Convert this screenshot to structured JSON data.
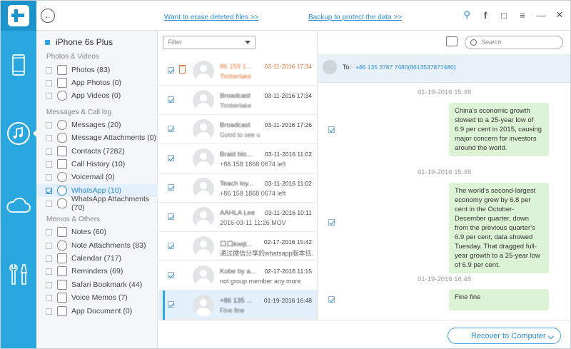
{
  "header": {
    "link_erase": "Want to erase deleted files >>",
    "link_backup": "Backup to protect the data >>"
  },
  "device": {
    "name": "iPhone 6s Plus"
  },
  "sidebar": {
    "groups": [
      "Photos & Videos",
      "Messages & Call log",
      "Memos & Others"
    ],
    "items": [
      {
        "label": "Photos (83)"
      },
      {
        "label": "App Photos (0)"
      },
      {
        "label": "App Videos (0)"
      },
      {
        "label": "Messages (20)"
      },
      {
        "label": "Message Attachments (0)"
      },
      {
        "label": "Contacts (7282)"
      },
      {
        "label": "Call History (10)"
      },
      {
        "label": "Voicemail (0)"
      },
      {
        "label": "WhatsApp (10)"
      },
      {
        "label": "WhatsApp Attachments (70)"
      },
      {
        "label": "Notes (60)"
      },
      {
        "label": "Note Attachments (83)"
      },
      {
        "label": "Calendar (717)"
      },
      {
        "label": "Reminders (69)"
      },
      {
        "label": "Safari Bookmark (44)"
      },
      {
        "label": "Voice Memos (7)"
      },
      {
        "label": "App Document (0)"
      }
    ]
  },
  "list": {
    "filter_placeholder": "Filter",
    "rows": [
      {
        "name": "86 159 1...",
        "date": "03-11-2016 17:34",
        "preview": "Timberlake"
      },
      {
        "name": "Broadcast",
        "date": "03-11-2016 17:34",
        "preview": "Timberlake"
      },
      {
        "name": "Broadcast",
        "date": "03-11-2016 17:26",
        "preview": "Good to see u"
      },
      {
        "name": "Braid blo...",
        "date": "03-11-2016 11:02",
        "preview": "+86 158 1868 0674 left"
      },
      {
        "name": "Teach loy...",
        "date": "03-11-2016 11:02",
        "preview": "+86 158 1868 0674 left"
      },
      {
        "name": "AAHLA Lee",
        "date": "03-11-2016 10:11",
        "preview": "2016-03-11 11:26.MOV"
      },
      {
        "name": "口口kwijt...",
        "date": "02-17-2016 15:42",
        "preview": "通过微信分享的whatsapp版本低..."
      },
      {
        "name": "Kobe by a...",
        "date": "02-17-2016 11:15",
        "preview": "not group member any more"
      },
      {
        "name": "+86 135 ...",
        "date": "01-19-2016 16:48",
        "preview": "Fine fine"
      }
    ]
  },
  "chat": {
    "search_placeholder": "Search",
    "to_label": "To:",
    "to_number": "+86 135 3787 7480(8613537877480)",
    "messages": [
      {
        "time": "01-19-2016 15:48",
        "text": "China's economic growth slowed to a 25-year low of 6.9 per cent in 2015, causing major concern for investors around the world."
      },
      {
        "time": "01-19-2016 15:48",
        "text": "The world's second-largest economy grew by 6.8 per cent in the October-December quarter, down from the previous quarter's 6.9 per cent, data showed Tuesday. That dragged full-year growth to a 25-year low of 6.9 per cent."
      },
      {
        "time": "01-19-2016 16:48",
        "text": "Fine fine"
      }
    ]
  },
  "footer": {
    "recover_label": "Recover to Computer"
  }
}
